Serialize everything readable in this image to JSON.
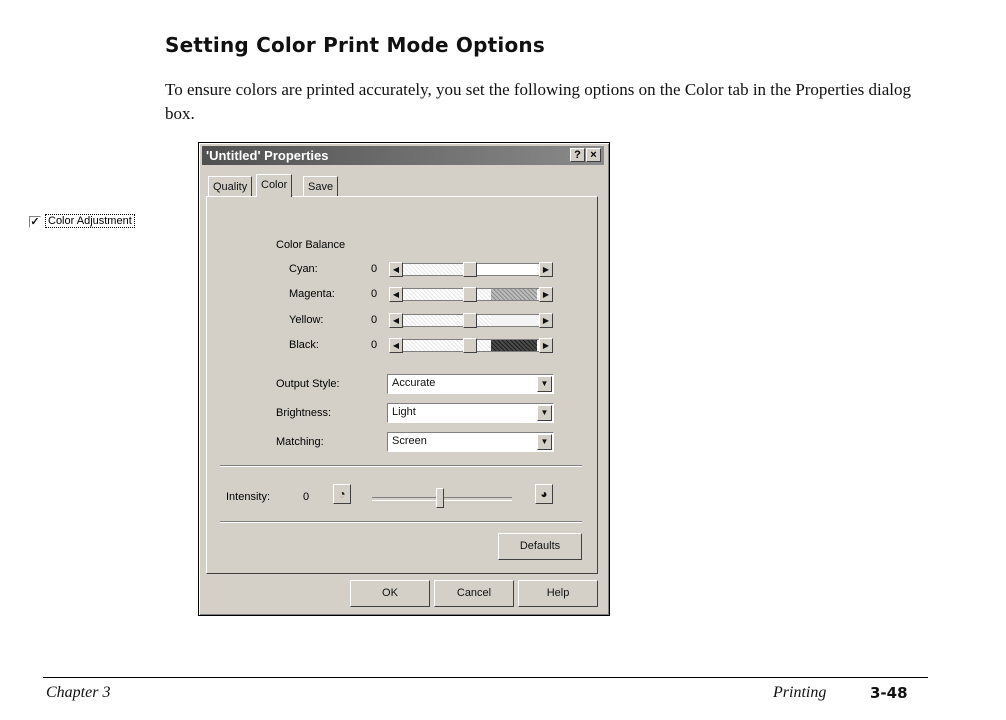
{
  "heading": "Setting Color Print Mode Options",
  "intro": "To ensure colors are printed accurately, you set the following options on the Color tab in the Properties dialog box.",
  "dialog": {
    "title": "'Untitled' Properties",
    "help_glyph": "?",
    "close_glyph": "×",
    "tabs": [
      "Quality",
      "Color",
      "Save"
    ],
    "color_adjustment_label": "Color Adjustment",
    "color_adjustment_checked": true,
    "color_balance_label": "Color Balance",
    "sliders": [
      {
        "label": "Cyan:",
        "value": "0",
        "fill": "#c8c8c8"
      },
      {
        "label": "Magenta:",
        "value": "0",
        "fill": "#a8a8a8"
      },
      {
        "label": "Yellow:",
        "value": "0",
        "fill": "#e0e0e0"
      },
      {
        "label": "Black:",
        "value": "0",
        "fill": "#303030"
      }
    ],
    "output_style": {
      "label": "Output Style:",
      "value": "Accurate"
    },
    "brightness": {
      "label": "Brightness:",
      "value": "Light"
    },
    "matching": {
      "label": "Matching:",
      "value": "Screen"
    },
    "intensity": {
      "label": "Intensity:",
      "value": "0"
    },
    "defaults_button": "Defaults",
    "ok_button": "OK",
    "cancel_button": "Cancel",
    "help_button": "Help"
  },
  "footer": {
    "chapter": "Chapter 3",
    "section": "Printing",
    "page": "3-48"
  }
}
